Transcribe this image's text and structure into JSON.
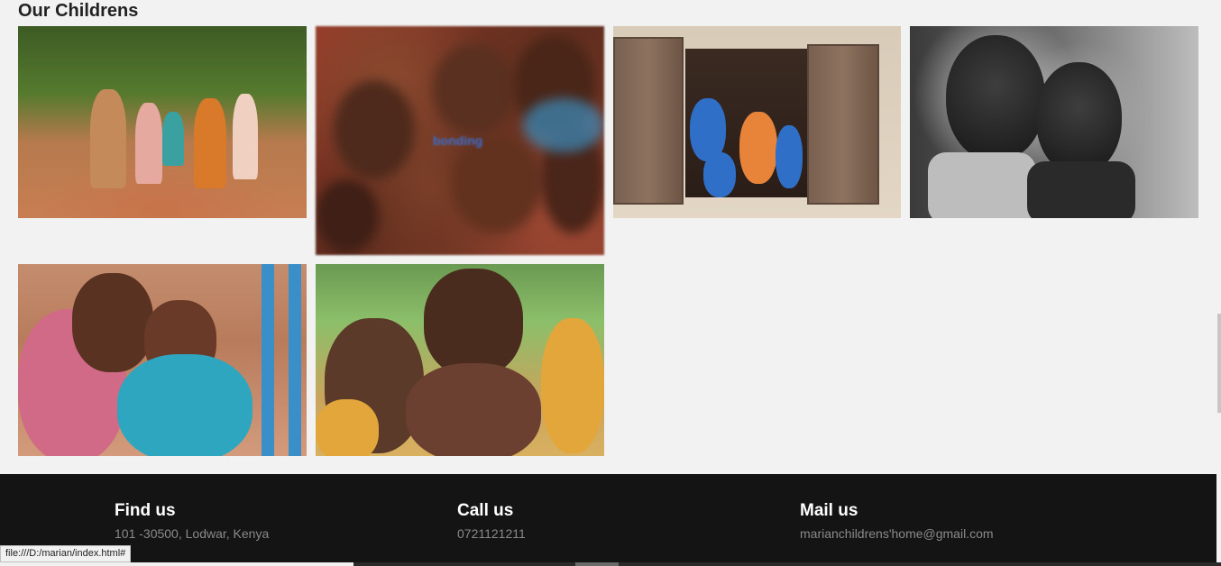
{
  "gallery": {
    "title": "Our Childrens",
    "images": [
      {
        "alt": "children running on a dirt path"
      },
      {
        "alt": "group of smiling children",
        "caption": "bonding"
      },
      {
        "alt": "children looking out of a window"
      },
      {
        "alt": "two girls black and white"
      },
      {
        "alt": "two girls hugging"
      },
      {
        "alt": "children at a gathering"
      }
    ]
  },
  "footer": {
    "find": {
      "heading": "Find us",
      "text": "101 -30500, Lodwar, Kenya"
    },
    "call": {
      "heading": "Call us",
      "text": "0721121211"
    },
    "mail": {
      "heading": "Mail us",
      "text": "marianchildrens'home@gmail.com"
    }
  },
  "status_bar": {
    "url": "file:///D:/marian/index.html#"
  }
}
